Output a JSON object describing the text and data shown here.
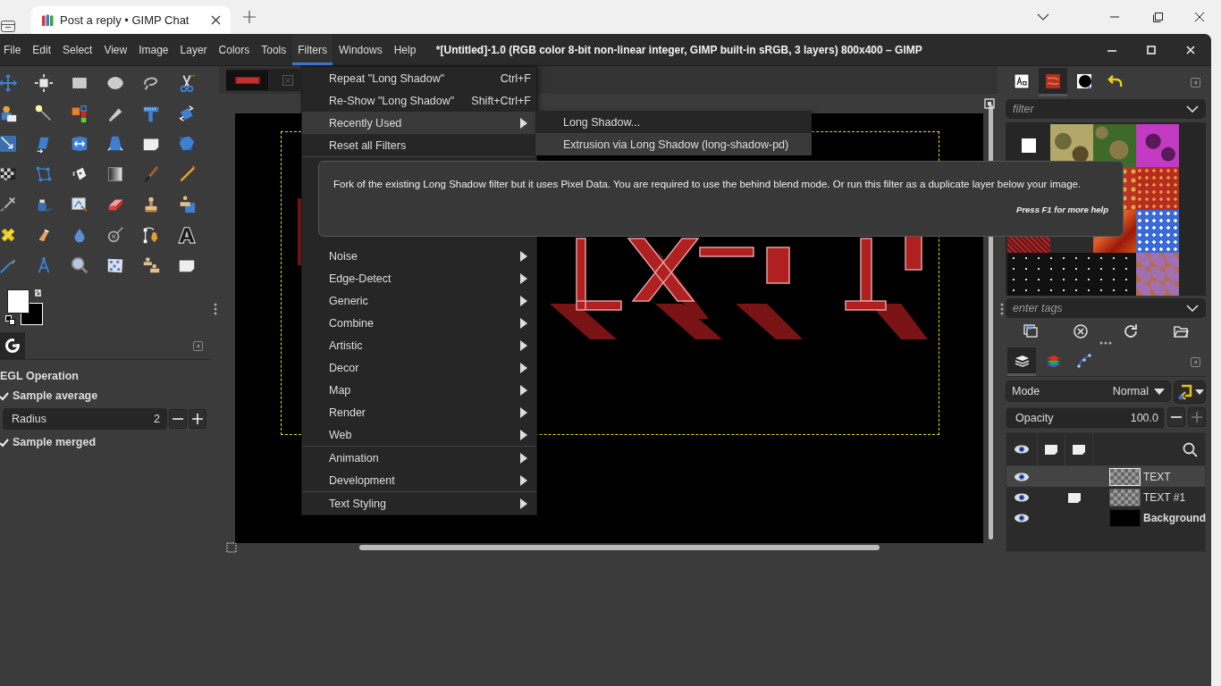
{
  "browser": {
    "tabs": [
      {
        "title": "Post a reply • GIMP Chat",
        "selected": true
      }
    ]
  },
  "window": {
    "title": "*[Untitled]-1.0 (RGB color 8-bit non-linear integer, GIMP built-in sRGB, 3 layers) 800x400 – GIMP"
  },
  "menubar": [
    {
      "label": "File",
      "selected": false
    },
    {
      "label": "Edit",
      "selected": false
    },
    {
      "label": "Select",
      "selected": false
    },
    {
      "label": "View",
      "selected": false
    },
    {
      "label": "Image",
      "selected": false
    },
    {
      "label": "Layer",
      "selected": false
    },
    {
      "label": "Colors",
      "selected": false
    },
    {
      "label": "Tools",
      "selected": false
    },
    {
      "label": "Filters",
      "selected": true
    },
    {
      "label": "Windows",
      "selected": false
    },
    {
      "label": "Help",
      "selected": false
    }
  ],
  "tool_options": {
    "title": "EGL Operation",
    "options": [
      {
        "kind": "checkbox",
        "label": "Sample average",
        "checked": true
      },
      {
        "kind": "spin",
        "label": "Radius",
        "value": "2"
      },
      {
        "kind": "checkbox",
        "label": "Sample merged",
        "checked": true
      }
    ]
  },
  "filters_menu": {
    "groups": [
      {
        "items": [
          {
            "kind": "action",
            "label": "Repeat \"Long Shadow\"",
            "shortcut": "Ctrl+F",
            "selected": false
          },
          {
            "kind": "action",
            "label": "Re-Show \"Long Shadow\"",
            "shortcut": "Shift+Ctrl+F",
            "selected": false
          },
          {
            "kind": "submenu",
            "label": "Recently Used",
            "selected": true
          },
          {
            "kind": "action",
            "label": "Reset all Filters",
            "selected": false
          }
        ]
      },
      {
        "items": [
          {
            "kind": "submenu",
            "label": "Noise",
            "selected": false
          },
          {
            "kind": "submenu",
            "label": "Edge-Detect",
            "selected": false
          },
          {
            "kind": "submenu",
            "label": "Generic",
            "selected": false
          },
          {
            "kind": "submenu",
            "label": "Combine",
            "selected": false
          },
          {
            "kind": "submenu",
            "label": "Artistic",
            "selected": false
          },
          {
            "kind": "submenu",
            "label": "Decor",
            "selected": false
          },
          {
            "kind": "submenu",
            "label": "Map",
            "selected": false
          },
          {
            "kind": "submenu",
            "label": "Render",
            "selected": false
          },
          {
            "kind": "submenu",
            "label": "Web",
            "selected": false
          }
        ]
      },
      {
        "items": [
          {
            "kind": "submenu",
            "label": "Animation",
            "selected": false
          },
          {
            "kind": "submenu",
            "label": "Development",
            "selected": false
          }
        ]
      },
      {
        "items": [
          {
            "kind": "submenu",
            "label": "Text Styling",
            "selected": false
          }
        ]
      }
    ]
  },
  "submenu": {
    "items": [
      {
        "label": "Long Shadow...",
        "selected": false
      },
      {
        "label": "Extrusion via Long Shadow (long-shadow-pd)",
        "selected": true
      }
    ]
  },
  "tooltip": {
    "text": "Fork of the existing Long Shadow filter but it uses Pixel Data. You are required to use the behind blend mode. Or run this filter as a duplicate layer below your image.",
    "hint": "Press F1 for more help"
  },
  "dock": {
    "tabs": [
      {
        "selected": false
      },
      {
        "selected": true
      },
      {
        "selected": false
      },
      {
        "selected": false
      }
    ],
    "filter": {
      "placeholder": "filter"
    },
    "tags": {
      "placeholder": "enter tags"
    }
  },
  "layers_dock": {
    "tabs": [
      {
        "selected": true
      },
      {
        "selected": false
      },
      {
        "selected": false
      }
    ],
    "mode_label": "Mode",
    "mode": "Normal",
    "opacity_label": "Opacity",
    "opacity": "100.0",
    "layers": [
      {
        "name": "TEXT",
        "selected": true,
        "visible": true,
        "linked": false,
        "emphasized": false
      },
      {
        "name": "TEXT #1",
        "selected": false,
        "visible": true,
        "linked": true,
        "emphasized": false
      },
      {
        "name": "Background",
        "selected": false,
        "visible": true,
        "linked": false,
        "emphasized": true
      }
    ]
  }
}
